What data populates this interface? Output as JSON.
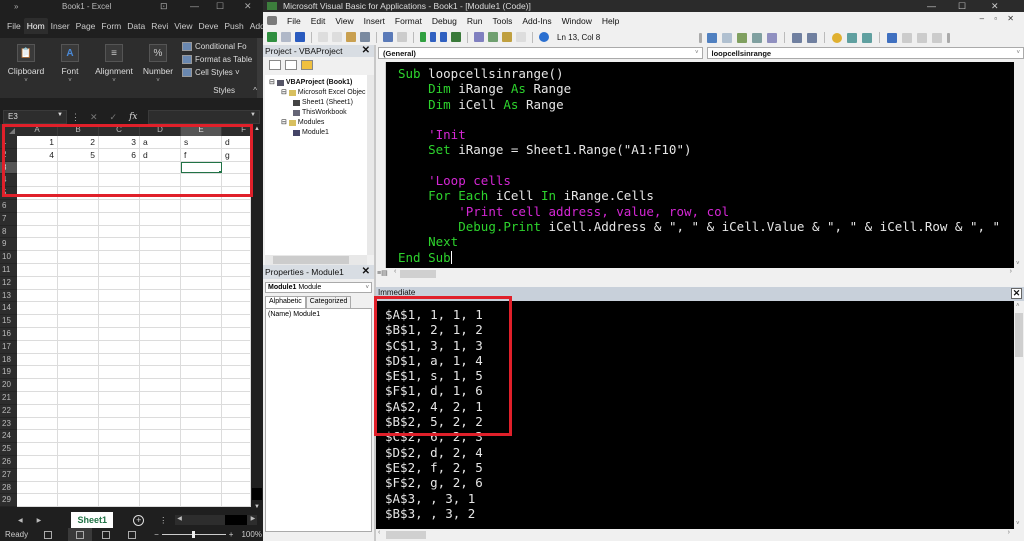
{
  "excel": {
    "title": "Book1  -  Excel",
    "qat_icon": "customize-quick-access",
    "window_controls": [
      "ribbon-display",
      "minimize",
      "maximize",
      "close"
    ],
    "tabs": [
      {
        "label": "File",
        "active": false
      },
      {
        "label": "Hom",
        "active": true
      },
      {
        "label": "Inser",
        "active": false
      },
      {
        "label": "Page",
        "active": false
      },
      {
        "label": "Form",
        "active": false
      },
      {
        "label": "Data",
        "active": false
      },
      {
        "label": "Revi",
        "active": false
      },
      {
        "label": "View",
        "active": false
      },
      {
        "label": "Deve",
        "active": false
      },
      {
        "label": "Push",
        "active": false
      },
      {
        "label": "Add-",
        "active": false
      }
    ],
    "ribbon": {
      "groups": [
        {
          "label": "Clipboard",
          "icon": "📋"
        },
        {
          "label": "Font",
          "icon": "A"
        },
        {
          "label": "Alignment",
          "icon": "≡"
        },
        {
          "label": "Number",
          "icon": "%"
        }
      ],
      "styles_items": [
        "Conditional Fo",
        "Format as Table",
        "Cell Styles ˅"
      ],
      "styles_label": "Styles",
      "collapse": "^"
    },
    "formula_bar": {
      "name_box": "E3",
      "cancel": "✕",
      "enter": "✓",
      "fx": "fx",
      "value": ""
    },
    "columns": [
      "A",
      "B",
      "C",
      "D",
      "E",
      "F"
    ],
    "selected_column": "E",
    "selected_row": 3,
    "rows": [
      {
        "n": "1",
        "cells": [
          {
            "v": "1",
            "num": true
          },
          {
            "v": "2",
            "num": true
          },
          {
            "v": "3",
            "num": true
          },
          {
            "v": "a"
          },
          {
            "v": "s"
          },
          {
            "v": "d"
          }
        ]
      },
      {
        "n": "2",
        "cells": [
          {
            "v": "4",
            "num": true
          },
          {
            "v": "5",
            "num": true
          },
          {
            "v": "6",
            "num": true
          },
          {
            "v": "d"
          },
          {
            "v": "f"
          },
          {
            "v": "g"
          }
        ]
      },
      {
        "n": "3",
        "cells": [
          {
            "v": ""
          },
          {
            "v": ""
          },
          {
            "v": ""
          },
          {
            "v": ""
          },
          {
            "v": "",
            "active": true
          },
          {
            "v": ""
          }
        ]
      },
      {
        "n": "4"
      },
      {
        "n": "5"
      },
      {
        "n": "6"
      },
      {
        "n": "7"
      },
      {
        "n": "8"
      },
      {
        "n": "9"
      },
      {
        "n": "10"
      },
      {
        "n": "11"
      },
      {
        "n": "12"
      },
      {
        "n": "13"
      },
      {
        "n": "14"
      },
      {
        "n": "15"
      },
      {
        "n": "16"
      },
      {
        "n": "17"
      },
      {
        "n": "18"
      },
      {
        "n": "19"
      },
      {
        "n": "20"
      },
      {
        "n": "21"
      },
      {
        "n": "22"
      },
      {
        "n": "23"
      },
      {
        "n": "24"
      },
      {
        "n": "25"
      },
      {
        "n": "26"
      },
      {
        "n": "27"
      },
      {
        "n": "28"
      },
      {
        "n": "29"
      }
    ],
    "sheet_tab": "Sheet1",
    "add_sheet": "+",
    "status": "Ready",
    "zoom": "100%",
    "zoom_minus": "−",
    "zoom_plus": "+"
  },
  "vba": {
    "title": "Microsoft Visual Basic for Applications - Book1 - [Module1 (Code)]",
    "menu": [
      "File",
      "Edit",
      "View",
      "Insert",
      "Format",
      "Debug",
      "Run",
      "Tools",
      "Add-Ins",
      "Window",
      "Help"
    ],
    "menu_mnemonics": [
      "F",
      "E",
      "V",
      "I",
      "o",
      "D",
      "R",
      "T",
      "A",
      "W",
      "H"
    ],
    "mdi_controls": "– ▫ ✕",
    "cursor_position": "Ln 13, Col 8",
    "project_pane": {
      "title": "Project - VBAProject",
      "tree": [
        {
          "label": "VBAProject (Book1)",
          "level": 0,
          "bold": true,
          "icon": "vbaproject-icon"
        },
        {
          "label": "Microsoft Excel Objec",
          "level": 1,
          "icon": "folder-icon"
        },
        {
          "label": "Sheet1 (Sheet1)",
          "level": 2,
          "icon": "sheet-icon"
        },
        {
          "label": "ThisWorkbook",
          "level": 2,
          "icon": "workbook-icon"
        },
        {
          "label": "Modules",
          "level": 1,
          "icon": "folder-icon"
        },
        {
          "label": "Module1",
          "level": 2,
          "icon": "module-icon"
        }
      ]
    },
    "properties_pane": {
      "title": "Properties - Module1",
      "object_name": "Module1",
      "object_type": "Module",
      "tabs": [
        "Alphabetic",
        "Categorized"
      ],
      "active_tab": "Alphabetic",
      "rows": [
        {
          "name": "(Name)",
          "value": "Module1"
        }
      ]
    },
    "code_pane": {
      "object_select": "(General)",
      "proc_select": "loopcellsinrange",
      "lines": [
        [
          {
            "t": "Sub",
            "c": "kw"
          },
          {
            "t": " loopcellsinrange()"
          }
        ],
        [
          {
            "t": "    "
          },
          {
            "t": "Dim",
            "c": "kw"
          },
          {
            "t": " iRange "
          },
          {
            "t": "As",
            "c": "kw"
          },
          {
            "t": " Range"
          }
        ],
        [
          {
            "t": "    "
          },
          {
            "t": "Dim",
            "c": "kw"
          },
          {
            "t": " iCell "
          },
          {
            "t": "As",
            "c": "kw"
          },
          {
            "t": " Range"
          }
        ],
        [
          {
            "t": ""
          }
        ],
        [
          {
            "t": "    "
          },
          {
            "t": "'Init",
            "c": "cm"
          }
        ],
        [
          {
            "t": "    "
          },
          {
            "t": "Set",
            "c": "kw"
          },
          {
            "t": " iRange = Sheet1.Range(\"A1:F10\")"
          }
        ],
        [
          {
            "t": ""
          }
        ],
        [
          {
            "t": "    "
          },
          {
            "t": "'Loop cells",
            "c": "cm"
          }
        ],
        [
          {
            "t": "    "
          },
          {
            "t": "For Each",
            "c": "kw"
          },
          {
            "t": " iCell "
          },
          {
            "t": "In",
            "c": "kw"
          },
          {
            "t": " iRange.Cells"
          }
        ],
        [
          {
            "t": "        "
          },
          {
            "t": "'Print cell address, value, row, col",
            "c": "cm"
          }
        ],
        [
          {
            "t": "        "
          },
          {
            "t": "Debug.Print",
            "c": "kw"
          },
          {
            "t": " iCell.Address & \", \" & iCell.Value & \", \" & iCell.Row & \", \""
          }
        ],
        [
          {
            "t": "    "
          },
          {
            "t": "Next",
            "c": "kw"
          }
        ],
        [
          {
            "t": "End Sub",
            "c": "kw",
            "caret": true
          }
        ]
      ]
    },
    "immediate": {
      "title": "Immediate",
      "lines": [
        "$A$1, 1, 1, 1",
        "$B$1, 2, 1, 2",
        "$C$1, 3, 1, 3",
        "$D$1, a, 1, 4",
        "$E$1, s, 1, 5",
        "$F$1, d, 1, 6",
        "$A$2, 4, 2, 1",
        "$B$2, 5, 2, 2",
        "$C$2, 6, 2, 3",
        "$D$2, d, 2, 4",
        "$E$2, f, 2, 5",
        "$F$2, g, 2, 6",
        "$A$3, , 3, 1",
        "$B$3, , 3, 2"
      ]
    }
  },
  "annotations": {
    "highlight_color": "#e0202a",
    "code_keyword_color": "#2dd32d",
    "code_comment_color": "#d427d4"
  }
}
